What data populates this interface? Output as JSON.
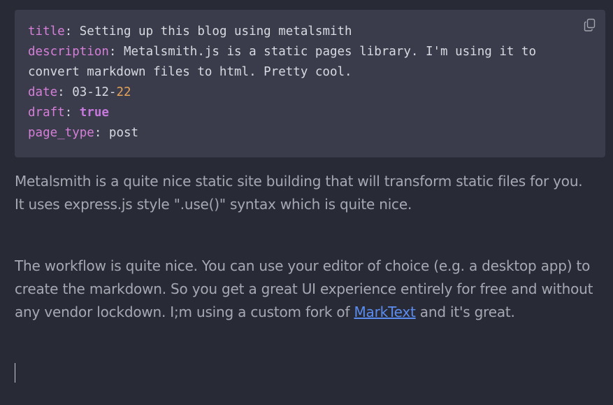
{
  "front_matter": {
    "lines": [
      {
        "key": "title",
        "sep": ": ",
        "value": "Setting up this blog using metalsmith"
      },
      {
        "key": "description",
        "sep": ": ",
        "value": "Metalsmith.js is a static pages library. I'm using it to"
      },
      {
        "continuation": "convert markdown files to html. Pretty cool."
      },
      {
        "key": "date",
        "sep": ": ",
        "value": "03-12-",
        "value_num": "22"
      },
      {
        "key": "draft",
        "sep": ": ",
        "value_bool": "true"
      },
      {
        "key": "page_type",
        "sep": ": ",
        "value": "post"
      }
    ],
    "copy_icon": "copy-icon"
  },
  "paragraphs": {
    "p1": "Metalsmith is a quite nice static site building that will transform static files for you. It uses express.js style \".use()\" syntax which is quite nice.",
    "p2_before": "The workflow is quite nice. You can use your editor of choice (e.g. a desktop app) to create the markdown. So you get a great UI experience entirely for free and without any vendor lockdown. I;m using a custom fork of ",
    "p2_link": "MarkText",
    "p2_after": " and it's great."
  },
  "colors": {
    "background": "#282a36",
    "code_background": "#3a3c4b",
    "yaml_key": "#d67fd8",
    "number": "#e5a35a",
    "link": "#5b8df0",
    "body_text": "#a6a9b2"
  }
}
